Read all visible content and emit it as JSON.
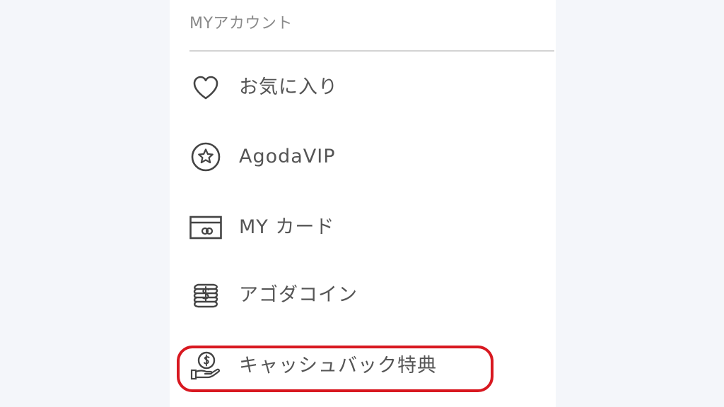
{
  "account_menu": {
    "section_title": "MYアカウント",
    "items": [
      {
        "label": "お気に入り",
        "icon": "heart-icon"
      },
      {
        "label": "AgodaVIP",
        "icon": "star-badge-icon"
      },
      {
        "label": "MY カード",
        "icon": "card-icon"
      },
      {
        "label": "アゴダコイン",
        "icon": "coin-stack-icon"
      },
      {
        "label": "キャッシュバック特典",
        "icon": "cashback-hand-icon"
      }
    ]
  },
  "colors": {
    "highlight": "#d81820",
    "text": "#555555",
    "icon": "#444444"
  }
}
